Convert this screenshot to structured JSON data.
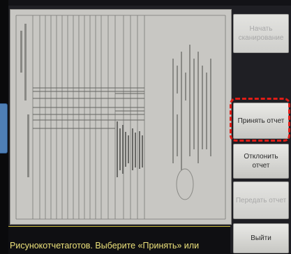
{
  "buttons": {
    "start_scan": "Начать сканирование",
    "accept_report": "Принять отчет",
    "reject_report": "Отклонить отчет",
    "send_report": "Передать отчет",
    "exit": "Выйти"
  },
  "status": {
    "message": "Рисунокотчетаготов. Выберите «Принять» или"
  },
  "colors": {
    "highlight": "#e11c16",
    "status_text": "#ece17a",
    "side_tab": "#4f7fb6"
  }
}
